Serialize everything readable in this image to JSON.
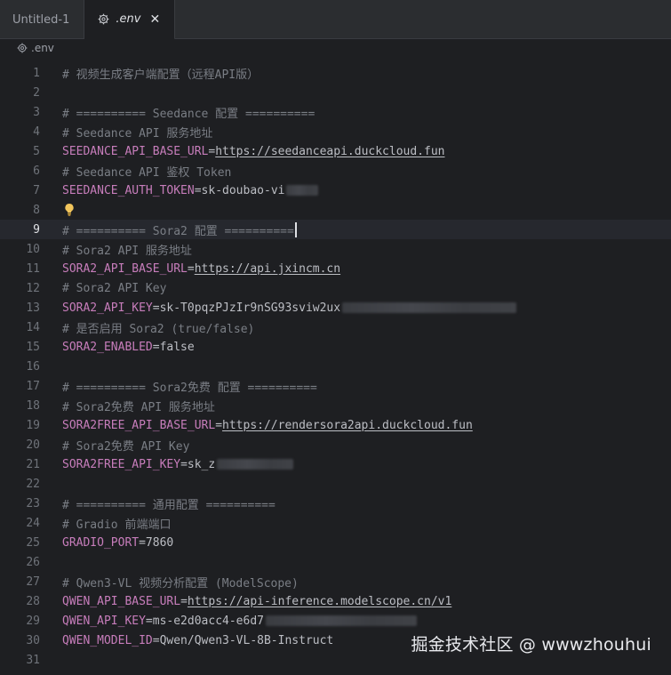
{
  "tabs": [
    {
      "label": "Untitled-1",
      "icon": "file-icon"
    },
    {
      "label": ".env",
      "icon": "gear-icon",
      "close": "✕"
    }
  ],
  "breadcrumb": {
    "label": ".env",
    "icon": "gear-icon"
  },
  "colors": {
    "comment": "#7a7e85",
    "key": "#c77dbb",
    "text": "#bcbec4",
    "background": "#1e1f22"
  },
  "editor": {
    "current_line": 9,
    "lines": [
      {
        "n": "1",
        "comment": "# 视频生成客户端配置（远程API版）"
      },
      {
        "n": "2"
      },
      {
        "n": "3",
        "comment": "# ========== Seedance 配置 =========="
      },
      {
        "n": "4",
        "comment": "# Seedance API 服务地址"
      },
      {
        "n": "5",
        "key": "SEEDANCE_API_BASE_URL",
        "url": "https://seedanceapi.duckcloud.fun"
      },
      {
        "n": "6",
        "comment": "# Seedance API 鉴权 Token"
      },
      {
        "n": "7",
        "key": "SEEDANCE_AUTH_TOKEN",
        "value": "sk-doubao-vi"
      },
      {
        "n": "8"
      },
      {
        "n": "9",
        "comment": "# ========== Sora2 配置 =========="
      },
      {
        "n": "10",
        "comment": "# Sora2 API 服务地址"
      },
      {
        "n": "11",
        "key": "SORA2_API_BASE_URL",
        "url": "https://api.jxincm.cn"
      },
      {
        "n": "12",
        "comment": "# Sora2 API Key"
      },
      {
        "n": "13",
        "key": "SORA2_API_KEY",
        "value": "sk-T0pqzPJzIr9nSG93sviw2ux"
      },
      {
        "n": "14",
        "comment": "# 是否启用 Sora2 (true/false)"
      },
      {
        "n": "15",
        "key": "SORA2_ENABLED",
        "value": "false"
      },
      {
        "n": "16"
      },
      {
        "n": "17",
        "comment": "# ========== Sora2免费 配置 =========="
      },
      {
        "n": "18",
        "comment": "# Sora2免费 API 服务地址"
      },
      {
        "n": "19",
        "key": "SORA2FREE_API_BASE_URL",
        "url": "https://rendersora2api.duckcloud.fun"
      },
      {
        "n": "20",
        "comment": "# Sora2免费 API Key"
      },
      {
        "n": "21",
        "key": "SORA2FREE_API_KEY",
        "value": "sk_z"
      },
      {
        "n": "22"
      },
      {
        "n": "23",
        "comment": "# ========== 通用配置 =========="
      },
      {
        "n": "24",
        "comment": "# Gradio 前端端口"
      },
      {
        "n": "25",
        "key": "GRADIO_PORT",
        "value": "7860"
      },
      {
        "n": "26"
      },
      {
        "n": "27",
        "comment": "# Qwen3-VL 视频分析配置 (ModelScope)"
      },
      {
        "n": "28",
        "key": "QWEN_API_BASE_URL",
        "url": "https://api-inference.modelscope.cn/v1"
      },
      {
        "n": "29",
        "key": "QWEN_API_KEY",
        "value": "ms-e2d0acc4-e6d7"
      },
      {
        "n": "30",
        "key": "QWEN_MODEL_ID",
        "value": "Qwen/Qwen3-VL-8B-Instruct"
      },
      {
        "n": "31"
      }
    ]
  },
  "watermark": "掘金技术社区 @ wwwzhouhui"
}
